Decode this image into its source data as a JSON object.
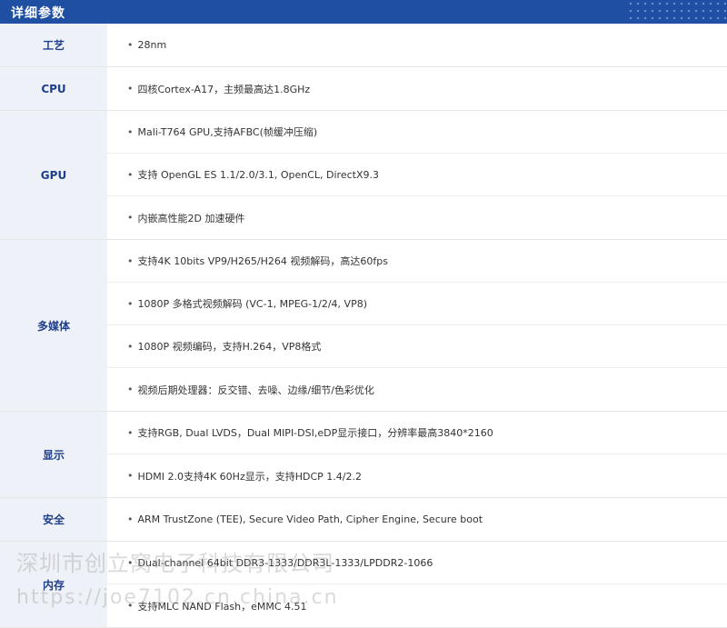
{
  "header": {
    "title": "详细参数"
  },
  "bullet": "•",
  "specs": [
    {
      "category": "工艺",
      "items": [
        "28nm"
      ]
    },
    {
      "category": "CPU",
      "items": [
        "四核Cortex-A17，主频最高达1.8GHz"
      ]
    },
    {
      "category": "GPU",
      "items": [
        "Mali-T764 GPU,支持AFBC(帧缓冲压缩)",
        "支持 OpenGL ES 1.1/2.0/3.1, OpenCL, DirectX9.3",
        "内嵌高性能2D 加速硬件"
      ]
    },
    {
      "category": "多媒体",
      "items": [
        "支持4K 10bits VP9/H265/H264 视频解码，高达60fps",
        "1080P 多格式视频解码 (VC-1, MPEG-1/2/4, VP8)",
        "1080P 视频编码，支持H.264，VP8格式",
        "视频后期处理器：反交错、去噪、边缘/细节/色彩优化"
      ]
    },
    {
      "category": "显示",
      "items": [
        "支持RGB, Dual LVDS，Dual MIPI-DSI,eDP显示接口，分辨率最高3840*2160",
        "HDMI 2.0支持4K 60Hz显示，支持HDCP 1.4/2.2"
      ]
    },
    {
      "category": "安全",
      "items": [
        "ARM TrustZone (TEE), Secure Video Path, Cipher Engine, Secure boot"
      ]
    },
    {
      "category": "内存",
      "items": [
        "Dual-channel 64bit DDR3-1333/DDR3L-1333/LPDDR2-1066",
        "支持MLC NAND Flash，eMMC 4.51"
      ]
    }
  ],
  "watermark": {
    "line1": "深圳市创立窝电子科技有限公司",
    "line2": "https://joe7102.cn.china.cn"
  },
  "colors": {
    "header_bg": "#1f4fa3",
    "category_bg": "#eef2f8",
    "category_text": "#1f3f8a"
  }
}
